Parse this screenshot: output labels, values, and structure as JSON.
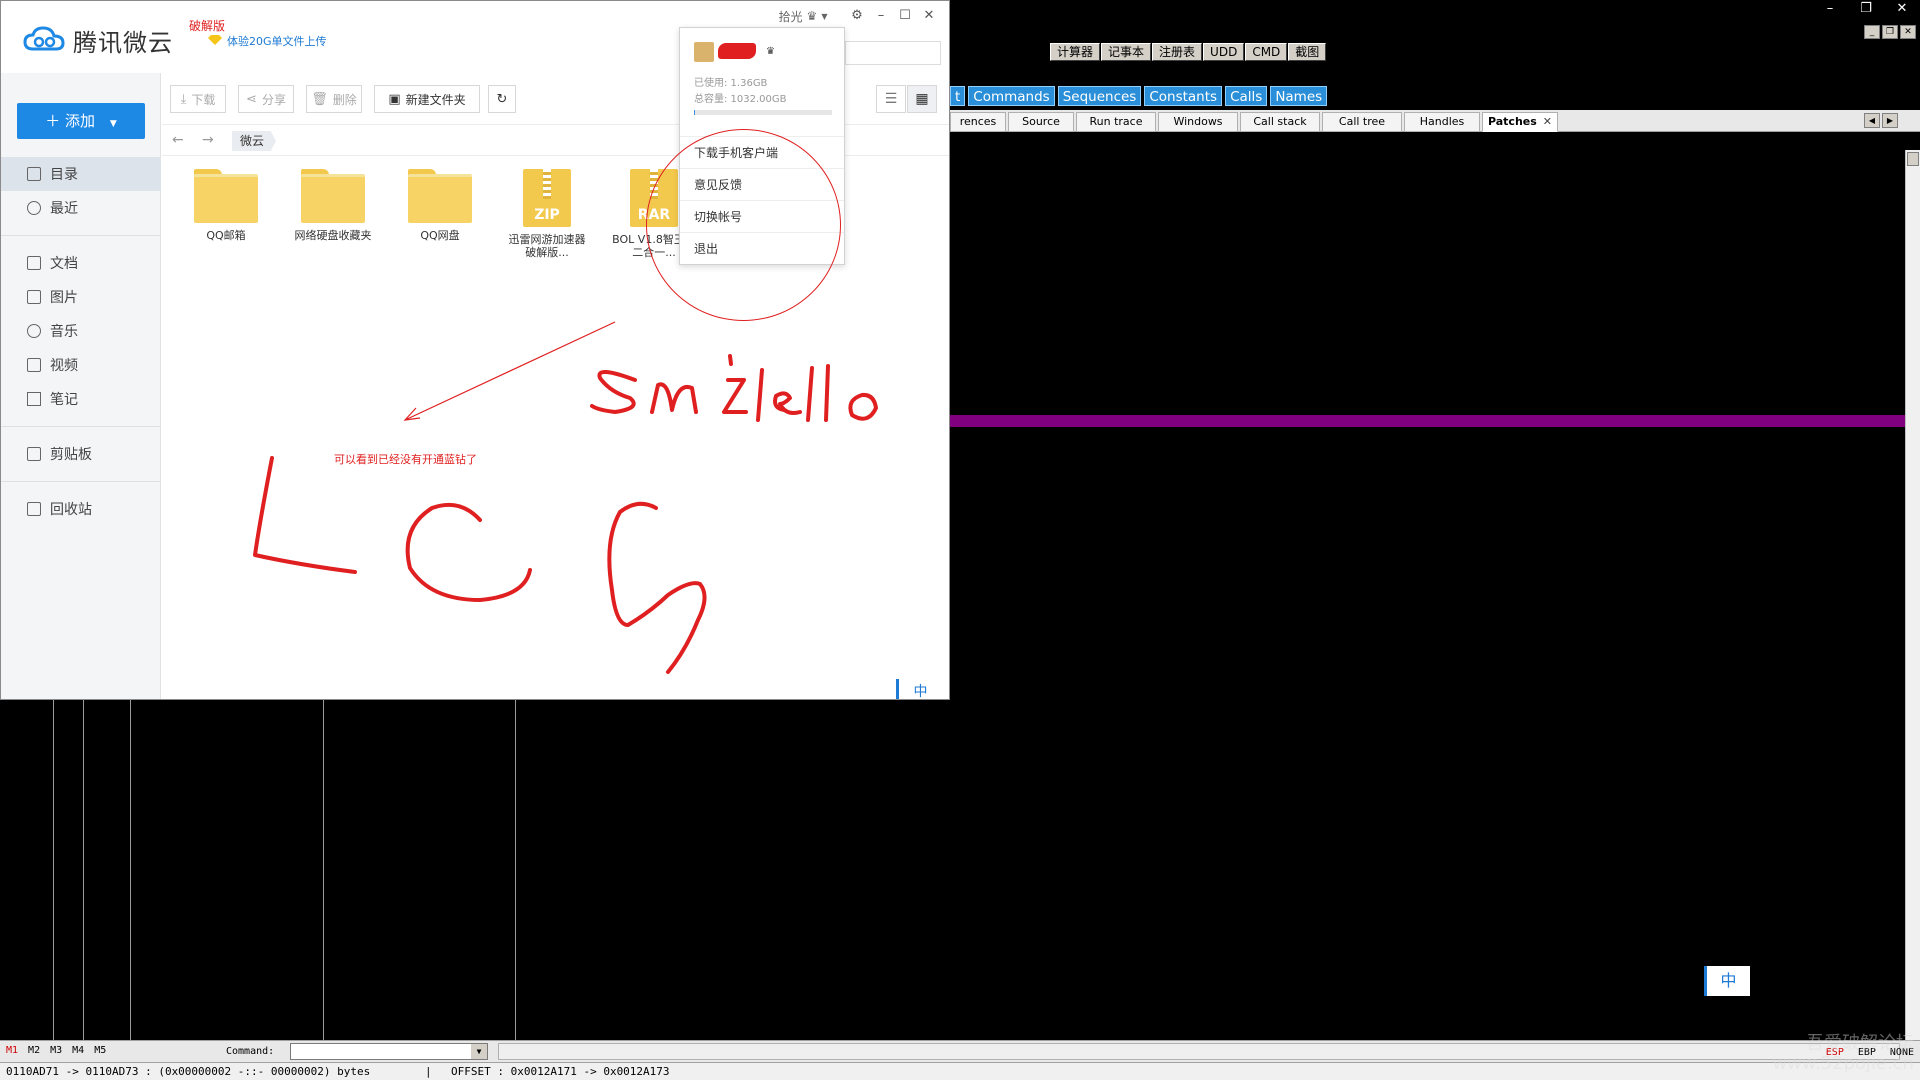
{
  "colors": {
    "weiyun_blue": "#1e88e5",
    "annotation_red": "#e02020",
    "olly_tab_blue": "#2a8fd8",
    "purple_line": "#800080"
  },
  "olly": {
    "window_controls": [
      "–",
      "❐",
      "✕"
    ],
    "toolbar_buttons": [
      "计算器",
      "记事本",
      "注册表",
      "UDD",
      "CMD",
      "截图"
    ],
    "window_tabs": [
      "t",
      "Commands",
      "Sequences",
      "Constants",
      "Calls",
      "Names"
    ],
    "panel_tabs": [
      "rences",
      "Source",
      "Run trace",
      "Windows",
      "Call stack",
      "Call tree",
      "Handles",
      "Patches"
    ],
    "patches_close": "✕",
    "ime_label": "中",
    "m_tabs": [
      "M1",
      "M2",
      "M3",
      "M4",
      "M5"
    ],
    "command_label": "Command:",
    "registers": [
      "ESP",
      "EBP",
      "NONE"
    ],
    "status_left": "0110AD71 -> 0110AD73 : (0x00000002  -::-  00000002) bytes",
    "status_sep": "|",
    "status_right": "OFFSET : 0x0012A171 -> 0x0012A173",
    "watermark_line1": "吾爱破解论坛",
    "watermark_line2": "www.52pojie.cn"
  },
  "weiyun": {
    "logo_text": "腾讯微云",
    "cracked_label": "破解版",
    "promo_text": "体验20G单文件上传",
    "user_trigger": "拾光",
    "add_button": "添加",
    "nav_items": [
      "目录",
      "最近",
      "文档",
      "图片",
      "音乐",
      "视频",
      "笔记",
      "剪贴板",
      "回收站"
    ],
    "toolbar": {
      "download": "下载",
      "share": "分享",
      "delete": "删除",
      "new_folder": "新建文件夹"
    },
    "breadcrumb": "微云",
    "files": [
      {
        "name": "QQ邮箱",
        "type": "folder"
      },
      {
        "name": "网络硬盘收藏夹",
        "type": "folder"
      },
      {
        "name": "QQ网盘",
        "type": "folder"
      },
      {
        "name": "迅雷网游加速器破解版...",
        "type": "zip",
        "label": "ZIP"
      },
      {
        "name": "BOL V1.8智王者二合一...",
        "type": "rar",
        "label": "RAR"
      }
    ],
    "annotation": "可以看到已经没有开通蓝钻了",
    "ime_label": "中",
    "popup": {
      "used": "已使用: 1.36GB",
      "total": "总容量: 1032.00GB",
      "usage_fraction": 0.0013,
      "menu": [
        "下载手机客户端",
        "意见反馈",
        "切换帐号",
        "退出"
      ]
    }
  },
  "handwriting": {
    "top": "smilello",
    "bottom": "LCG"
  }
}
